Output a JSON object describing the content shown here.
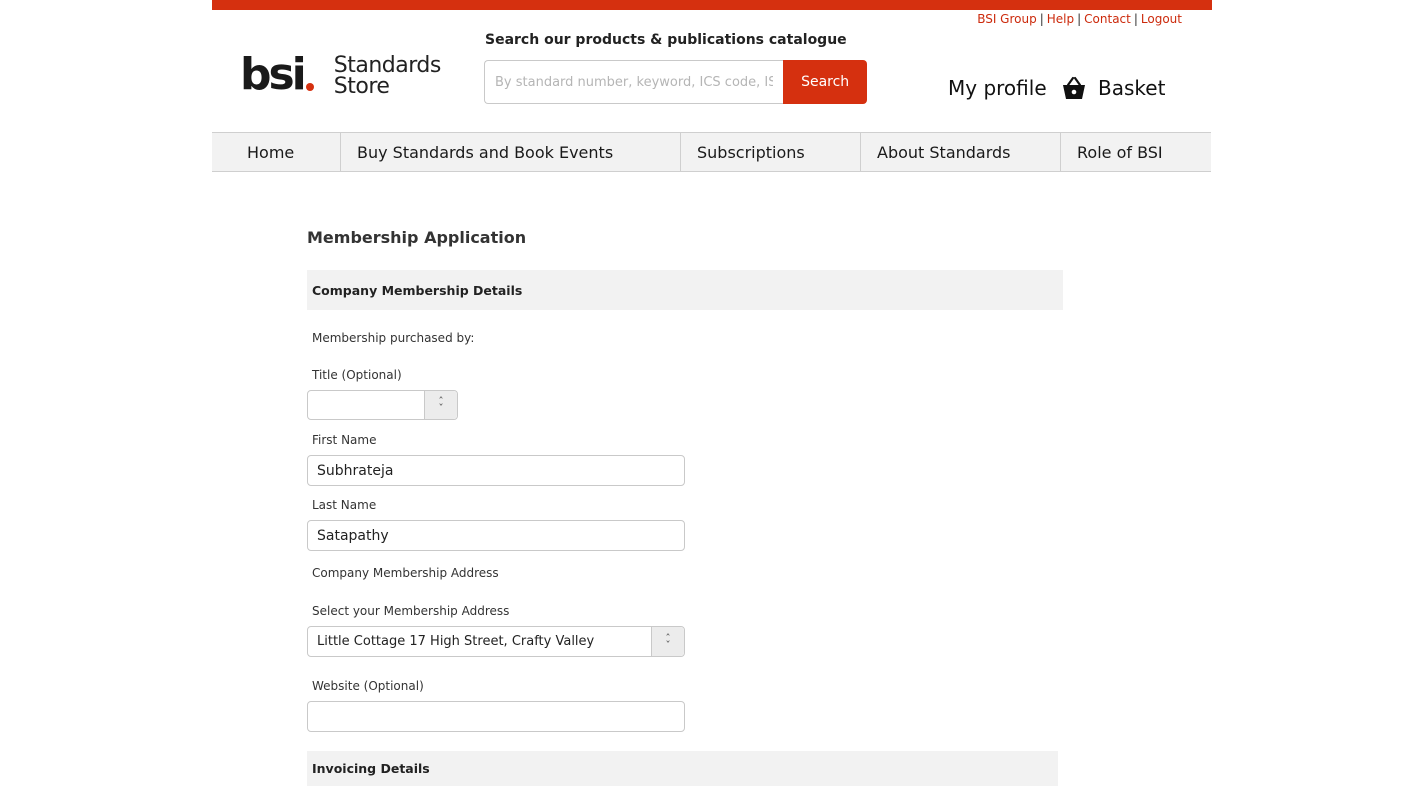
{
  "theme": {
    "accent": "#d5300f",
    "link_color": "#cc2a0c",
    "section_bg": "#f2f2f2"
  },
  "util_links": {
    "bsi_group": "BSI Group",
    "help": "Help",
    "contact": "Contact",
    "logout": "Logout",
    "separator": "|"
  },
  "logo": {
    "brand": "bsi",
    "line1": "Standards",
    "line2": "Store"
  },
  "search": {
    "heading": "Search our products & publications catalogue",
    "placeholder": "By standard number, keyword, ICS code, ISBN",
    "button": "Search"
  },
  "account": {
    "profile": "My profile",
    "basket": "Basket",
    "basket_icon": "basket-icon"
  },
  "nav": [
    "Home",
    "Buy Standards and Book Events",
    "Subscriptions",
    "About Standards",
    "Role of BSI"
  ],
  "form": {
    "title": "Membership Application",
    "company_section": "Company Membership Details",
    "purchased_by": "Membership purchased by:",
    "title_label": "Title (Optional)",
    "title_value": "",
    "first_name_label": "First Name",
    "first_name_value": "Subhrateja",
    "last_name_label": "Last Name",
    "last_name_value": "Satapathy",
    "address_heading": "Company Membership Address",
    "address_select_label": "Select your Membership Address",
    "address_value": "Little Cottage 17 High Street, Crafty Valley",
    "website_label": "Website (Optional)",
    "website_value": "",
    "invoicing_section": "Invoicing Details"
  }
}
